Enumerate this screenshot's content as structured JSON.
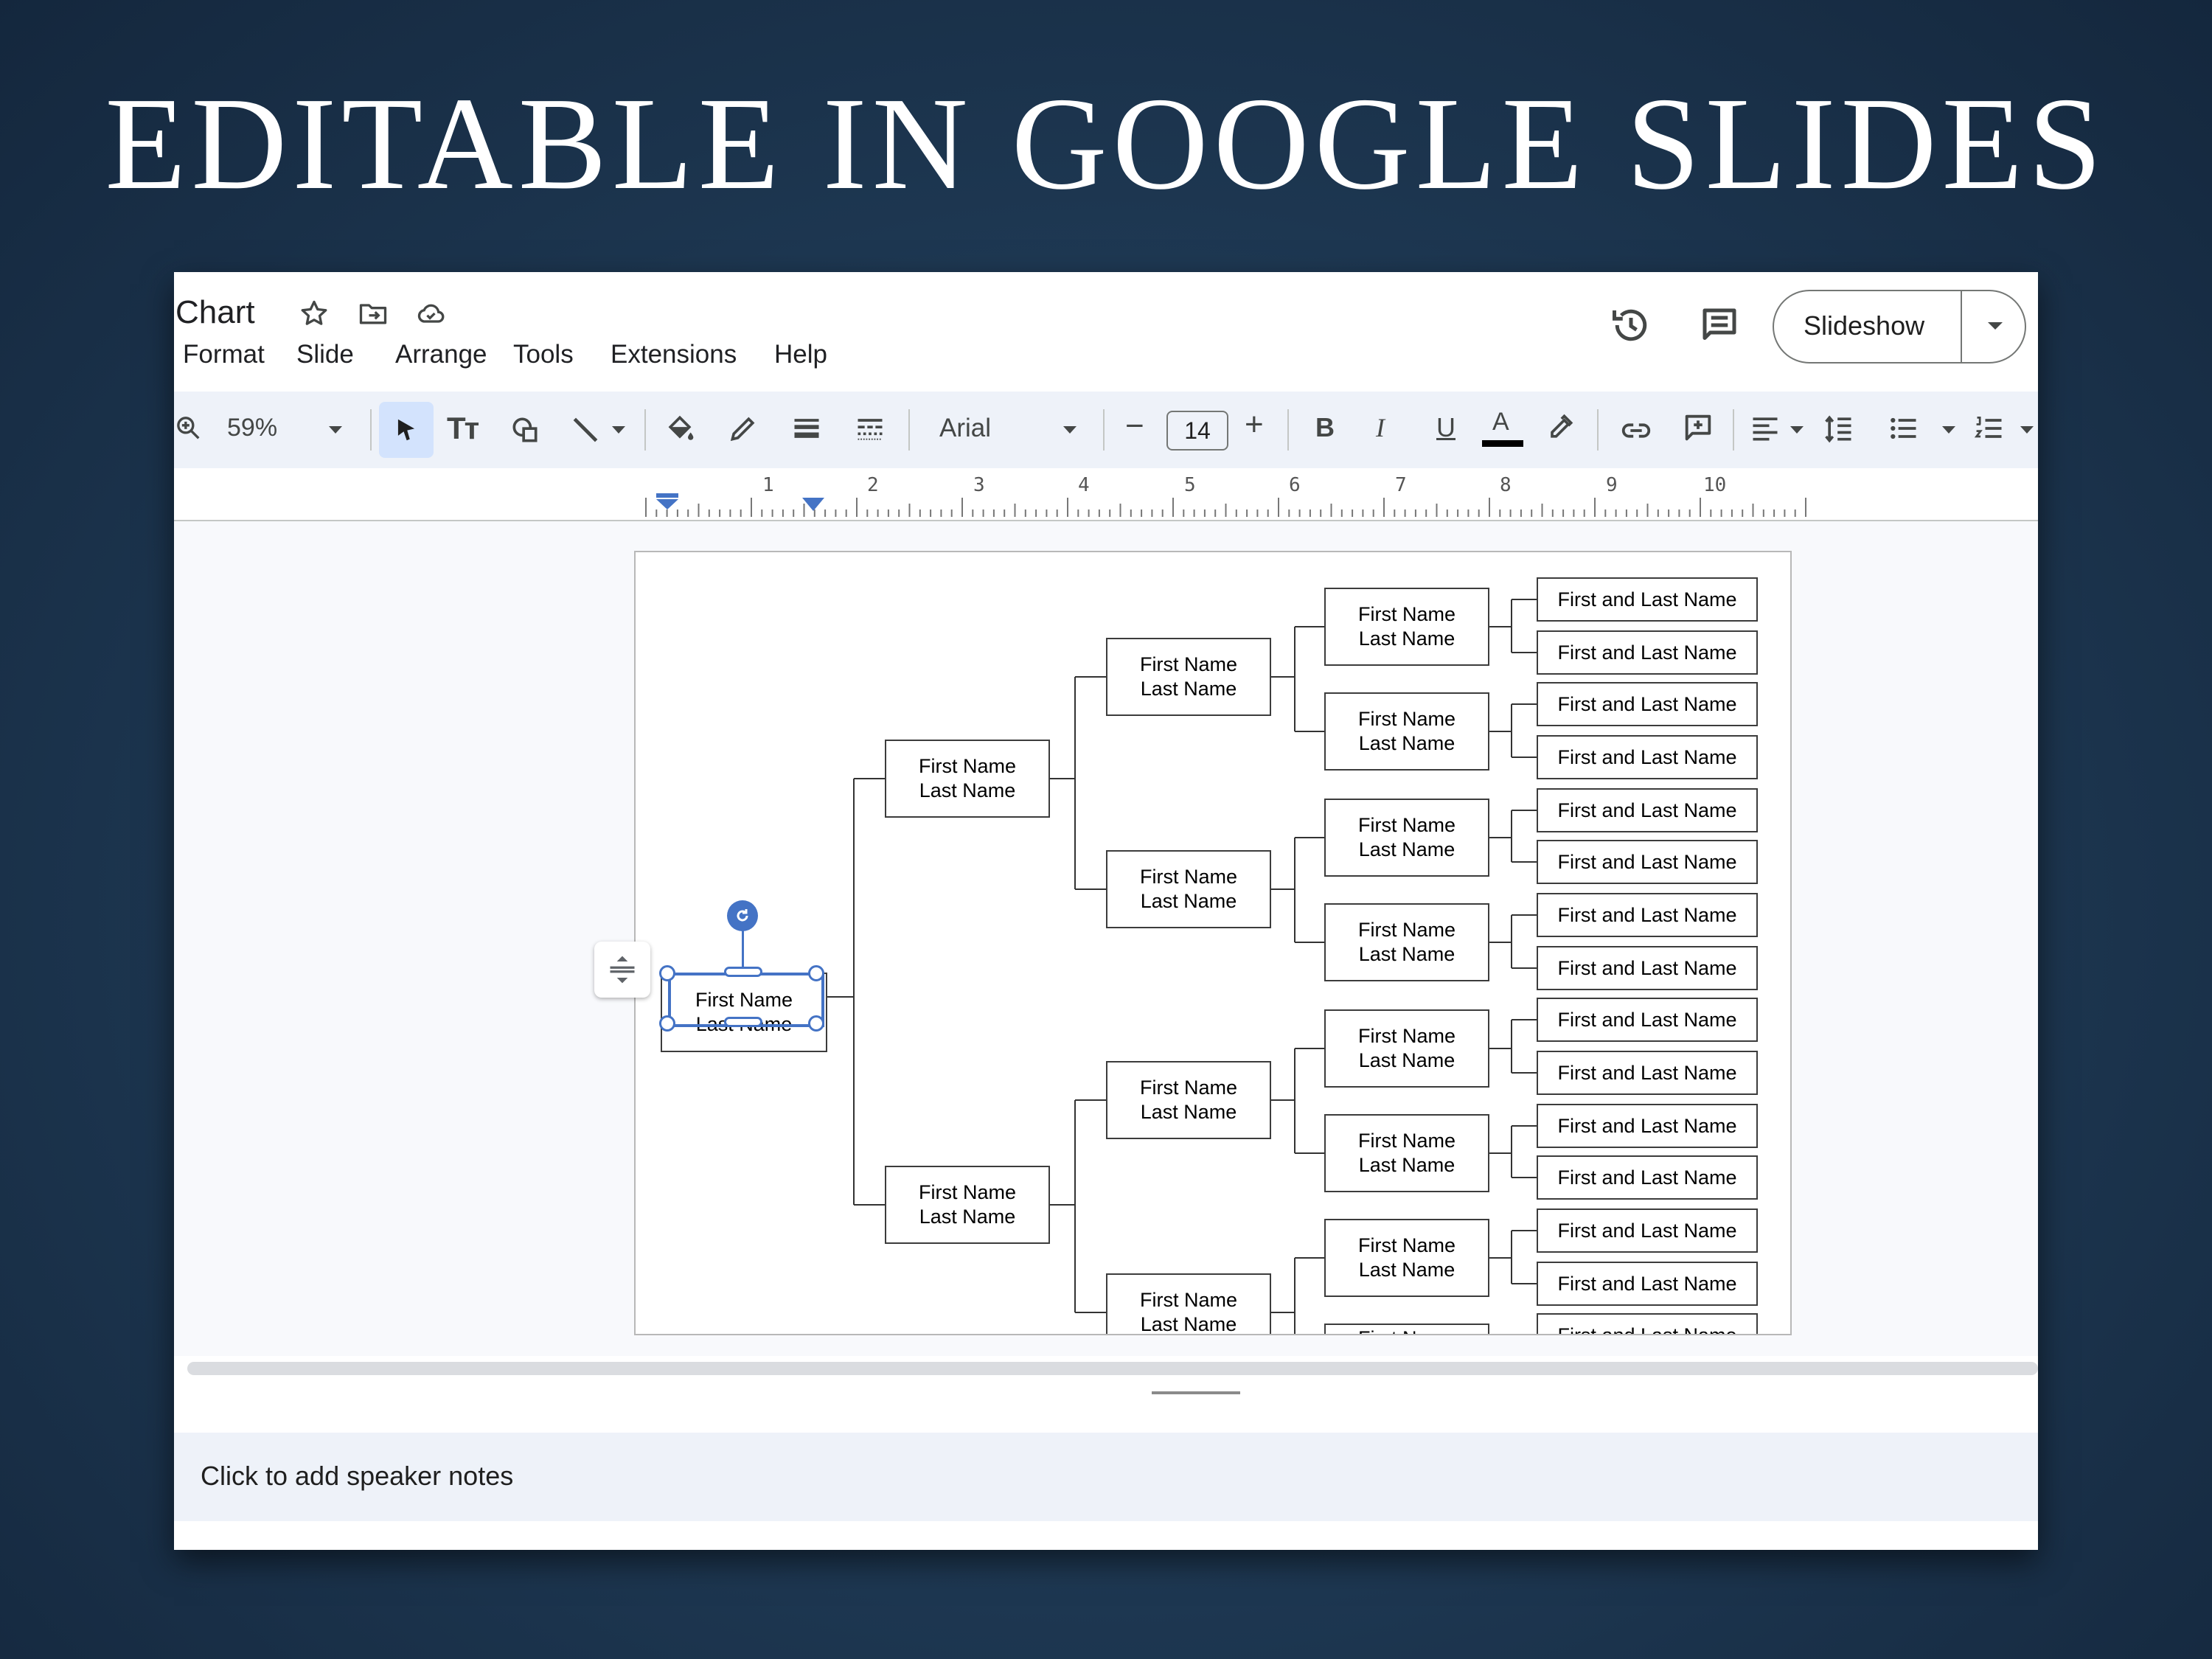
{
  "banner": {
    "title": "EDITABLE IN GOOGLE SLIDES"
  },
  "app": {
    "doc_title": "Chart",
    "menu": [
      "Format",
      "Slide",
      "Arrange",
      "Tools",
      "Extensions",
      "Help"
    ],
    "slideshow_label": "Slideshow"
  },
  "toolbar": {
    "zoom": "59%",
    "font": "Arial",
    "font_size": "14",
    "bold": "B",
    "italic": "I",
    "underline": "U",
    "text_color": "A",
    "text_color_value": "#000000"
  },
  "ruler": {
    "numbers": [
      "1",
      "2",
      "3",
      "4",
      "5",
      "6",
      "7",
      "8",
      "9",
      "10"
    ]
  },
  "chart": {
    "root": {
      "line1": "First Name",
      "line2": "Last Name"
    },
    "level1": [
      {
        "line1": "First Name",
        "line2": "Last Name"
      },
      {
        "line1": "First Name",
        "line2": "Last Name"
      }
    ],
    "level2": [
      {
        "line1": "First Name",
        "line2": "Last Name"
      },
      {
        "line1": "First Name",
        "line2": "Last Name"
      },
      {
        "line1": "First Name",
        "line2": "Last Name"
      },
      {
        "line1": "First Name",
        "line2": "Last Name"
      }
    ],
    "level3": [
      {
        "line1": "First Name",
        "line2": "Last Name"
      },
      {
        "line1": "First Name",
        "line2": "Last Name"
      },
      {
        "line1": "First Name",
        "line2": "Last Name"
      },
      {
        "line1": "First Name",
        "line2": "Last Name"
      },
      {
        "line1": "First Name",
        "line2": "Last Name"
      },
      {
        "line1": "First Name",
        "line2": "Last Name"
      },
      {
        "line1": "First Name",
        "line2": "Last Name"
      },
      {
        "line1": "First Name",
        "line2": ""
      }
    ],
    "level4": [
      "First and Last Name",
      "First and Last Name",
      "First and Last Name",
      "First and Last Name",
      "First and Last Name",
      "First and Last Name",
      "First and Last Name",
      "First and Last Name",
      "First and Last Name",
      "First and Last Name",
      "First and Last Name",
      "First and Last Name",
      "First and Last Name",
      "First and Last Name",
      "First and Last Name"
    ]
  },
  "notes": {
    "placeholder": "Click to add speaker notes"
  },
  "colors": {
    "accent": "#4473c5",
    "toolbar_bg": "#eef2f9",
    "selected_tool_bg": "#d3e3fd"
  }
}
